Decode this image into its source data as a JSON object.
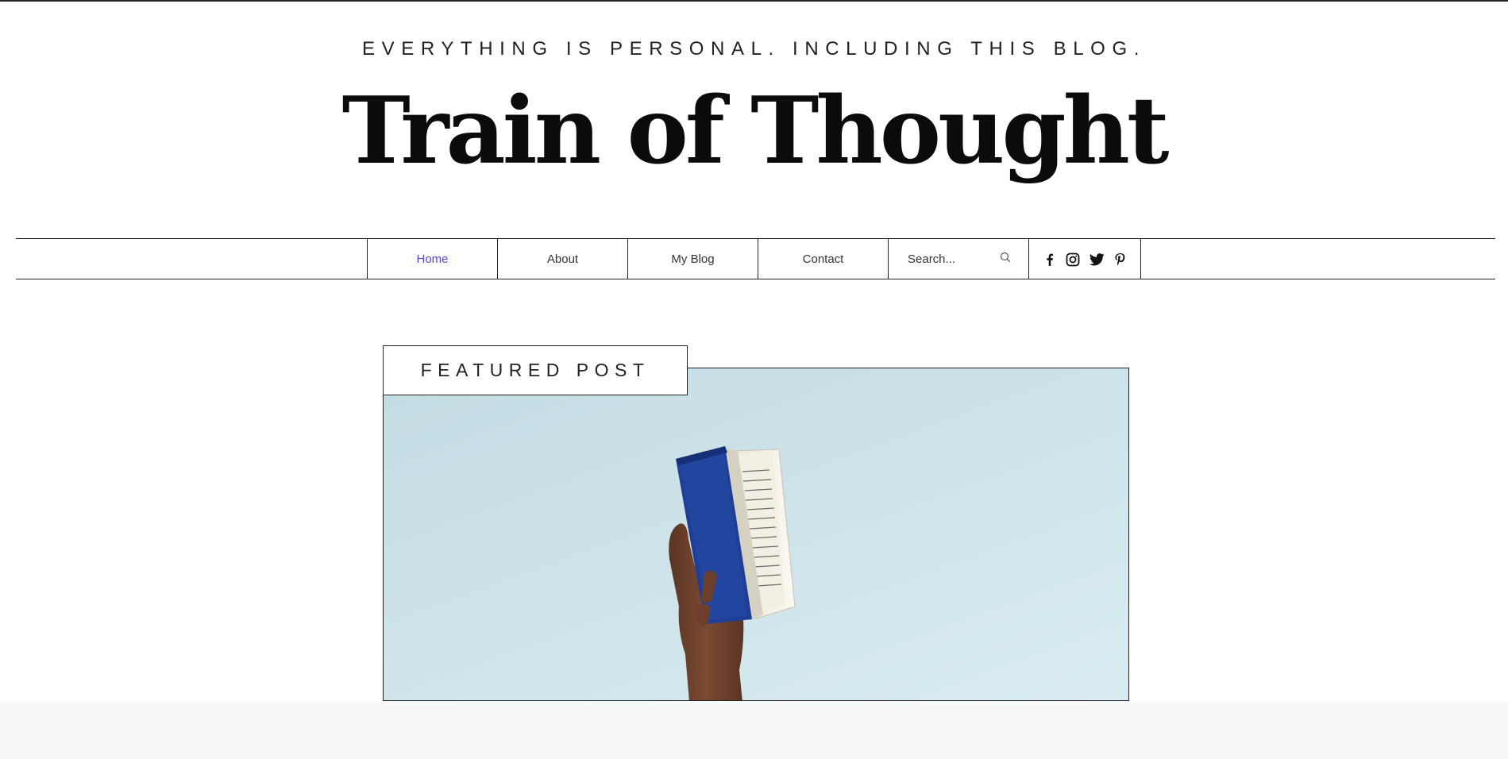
{
  "header": {
    "tagline": "EVERYTHING IS PERSONAL. INCLUDING THIS BLOG.",
    "title": "Train of Thought"
  },
  "nav": {
    "items": [
      {
        "label": "Home",
        "active": true
      },
      {
        "label": "About",
        "active": false
      },
      {
        "label": "My Blog",
        "active": false
      },
      {
        "label": "Contact",
        "active": false
      }
    ],
    "search": {
      "placeholder": "Search..."
    },
    "social": [
      "facebook-icon",
      "instagram-icon",
      "twitter-icon",
      "pinterest-icon"
    ],
    "active_color": "#5b3fd6"
  },
  "featured": {
    "label": "FEATURED POST",
    "image": "hand-holding-open-blue-book"
  },
  "colors": {
    "hero_bg": "#cde3e9",
    "book_cover": "#1e3f95"
  }
}
